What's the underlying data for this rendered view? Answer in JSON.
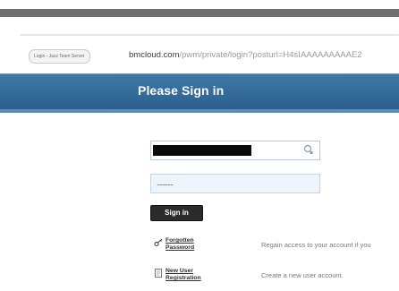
{
  "browser": {
    "tab_title": "Login - Jazz Team Server",
    "url_domain": "bmcloud.com",
    "url_path": "/pwm/private/login?posturl=H4sIAAAAAAAAAE2"
  },
  "header": {
    "title": "Please Sign in"
  },
  "form": {
    "password_mask": "............",
    "signin_label": "Sign in"
  },
  "links": [
    {
      "label": "Forgotten Password",
      "description": "Regain access to your account if you",
      "icon": "key-icon"
    },
    {
      "label": "New User Registration",
      "description": "Create a new user account.",
      "icon": "document-icon"
    }
  ],
  "colors": {
    "header_blue": "#2f6796",
    "button_dark": "#2b2b2b"
  }
}
